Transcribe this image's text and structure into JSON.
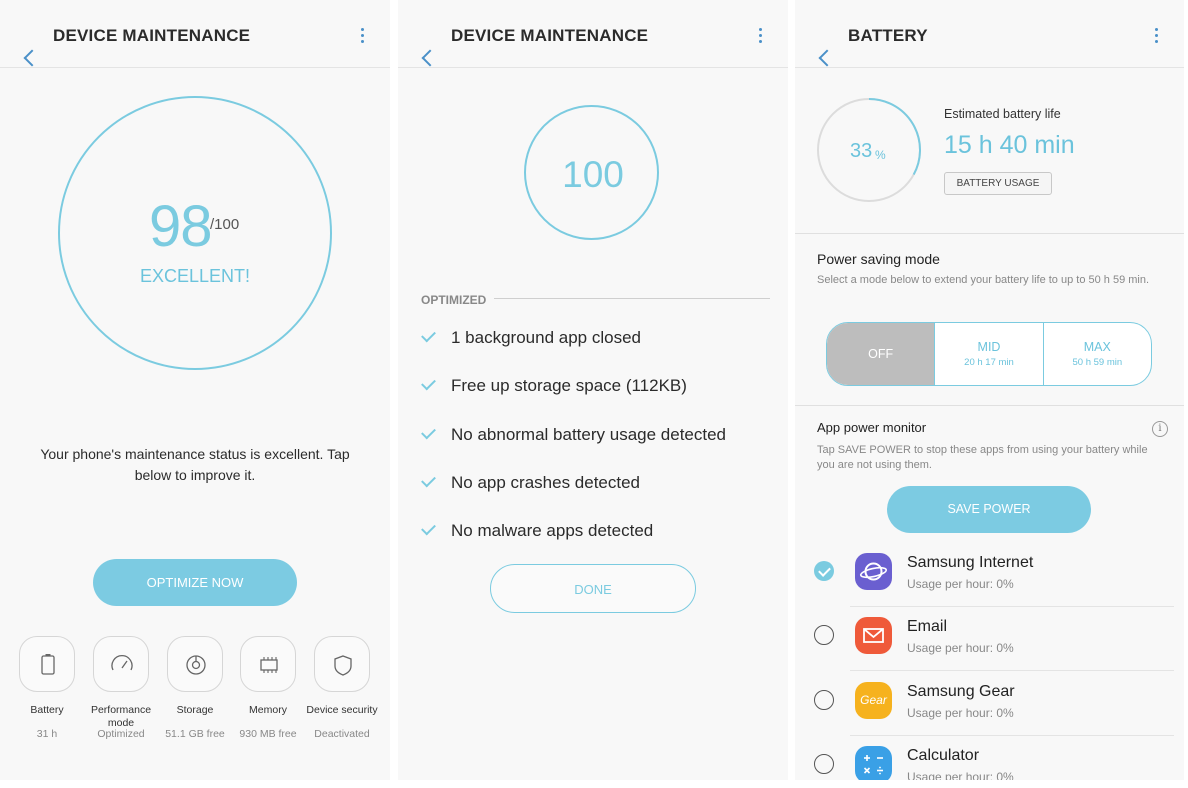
{
  "panel1": {
    "title": "DEVICE MAINTENANCE",
    "score": "98",
    "score_max": "/100",
    "status": "EXCELLENT!",
    "message": "Your phone's maintenance status is excellent. Tap below to improve it.",
    "optimize_label": "OPTIMIZE NOW",
    "tiles": [
      {
        "icon": "battery-icon",
        "label": "Battery",
        "sub": "31 h"
      },
      {
        "icon": "speedometer-icon",
        "label": "Performance mode",
        "sub": "Optimized"
      },
      {
        "icon": "disk-icon",
        "label": "Storage",
        "sub": "51.1 GB free"
      },
      {
        "icon": "chip-icon",
        "label": "Memory",
        "sub": "930 MB free"
      },
      {
        "icon": "shield-icon",
        "label": "Device security",
        "sub": "Deactivated"
      }
    ]
  },
  "panel2": {
    "title": "DEVICE MAINTENANCE",
    "score": "100",
    "section_label": "OPTIMIZED",
    "items": [
      "1 background app closed",
      "Free up storage space (112KB)",
      "No abnormal battery usage detected",
      "No app crashes detected",
      "No malware apps detected"
    ],
    "done_label": "DONE"
  },
  "panel3": {
    "title": "BATTERY",
    "battery_percent": "33",
    "percent_sign": "%",
    "battery_level": 0.33,
    "estimated_label": "Estimated battery life",
    "estimated_value": "15 h 40 min",
    "usage_button": "BATTERY USAGE",
    "power_saving_title": "Power saving mode",
    "power_saving_desc": "Select a mode below to extend your battery life to up to 50 h 59 min.",
    "modes": [
      {
        "label": "OFF",
        "sub": ""
      },
      {
        "label": "MID",
        "sub": "20 h 17 min"
      },
      {
        "label": "MAX",
        "sub": "50 h 59 min"
      }
    ],
    "selected_mode": "OFF",
    "app_monitor_title": "App power monitor",
    "app_monitor_desc": "Tap SAVE POWER to stop these apps from using your battery while you are not using them.",
    "save_label": "SAVE POWER",
    "apps": [
      {
        "name": "Samsung Internet",
        "usage": "Usage per hour: 0%",
        "checked": true,
        "color": "#6a5fd0",
        "icon": "planet-icon"
      },
      {
        "name": "Email",
        "usage": "Usage per hour: 0%",
        "checked": false,
        "color": "#ef5a3a",
        "icon": "envelope-icon"
      },
      {
        "name": "Samsung Gear",
        "usage": "Usage per hour: 0%",
        "checked": false,
        "color": "#f6b21e",
        "icon": "gear-logo-icon",
        "icon_text": "Gear"
      },
      {
        "name": "Calculator",
        "usage": "Usage per hour: 0%",
        "checked": false,
        "color": "#3aa0e6",
        "icon": "calculator-icon"
      }
    ]
  },
  "colors": {
    "accent": "#7bcbe0",
    "button_fill": "#7ccbe2",
    "link_blue": "#4a90c8"
  }
}
